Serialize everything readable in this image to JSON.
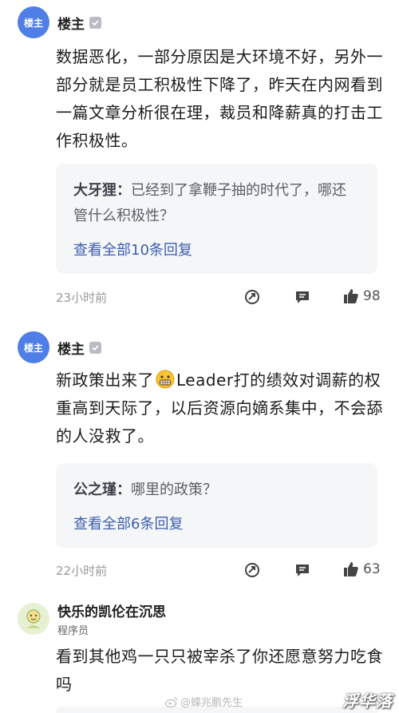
{
  "posts": [
    {
      "author": "楼主",
      "avatar_text": "楼主",
      "verified": true,
      "body": "数据恶化，一部分原因是大环境不好，另外一部分就是员工积极性下降了，昨天在内网看到一篇文章分析很在理，裁员和降薪真的打击工作积极性。",
      "reply": {
        "author": "大牙狸：",
        "text": "已经到了拿鞭子抽的时代了，哪还管什么积极性？",
        "view_all": "查看全部10条回复"
      },
      "time": "23小时前",
      "likes": "98"
    },
    {
      "author": "楼主",
      "avatar_text": "楼主",
      "verified": true,
      "body_part1": "新政策出来了",
      "emoji": "grimacing-face-icon",
      "body_part2": "Leader打的绩效对调薪的权重高到天际了，以后资源向嫡系集中，不会舔的人没救了。",
      "reply": {
        "author": "公之瑾：",
        "text": "哪里的政策？",
        "view_all": "查看全部6条回复"
      },
      "time": "22小时前",
      "likes": "63"
    },
    {
      "author": "快乐的凯伦在沉思",
      "subtitle": "程序员",
      "body": "看到其他鸡一只只被宰杀了你还愿意努力吃食吗"
    }
  ],
  "watermark": "@蝶兆鹏先生",
  "brand": "浮华落",
  "colors": {
    "host_avatar": "#4f7fe6",
    "link": "#3c5fae",
    "reply_bg": "#f5f6f8"
  }
}
